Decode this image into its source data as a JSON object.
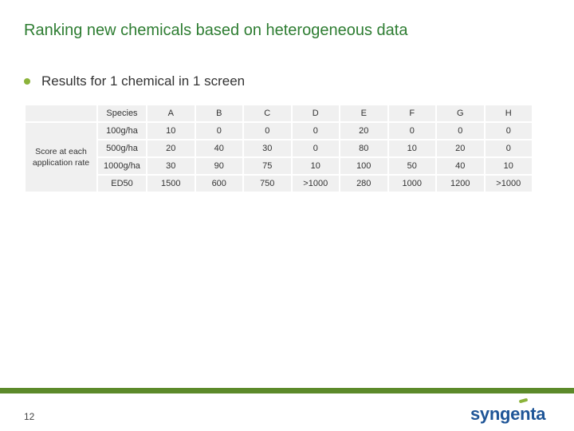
{
  "slide": {
    "title": "Ranking new chemicals based on heterogeneous data",
    "bullet": "Results for 1 chemical in 1 screen",
    "page_number": "12",
    "logo_text": "syngenta"
  },
  "table": {
    "row_group_label": "Score at each application rate",
    "header_label": "Species",
    "species": [
      "A",
      "B",
      "C",
      "D",
      "E",
      "F",
      "G",
      "H"
    ],
    "rows": [
      {
        "label": "100g/ha",
        "values": [
          "10",
          "0",
          "0",
          "0",
          "20",
          "0",
          "0",
          "0"
        ]
      },
      {
        "label": "500g/ha",
        "values": [
          "20",
          "40",
          "30",
          "0",
          "80",
          "10",
          "20",
          "0"
        ]
      },
      {
        "label": "1000g/ha",
        "values": [
          "30",
          "90",
          "75",
          "10",
          "100",
          "50",
          "40",
          "10"
        ]
      },
      {
        "label": "ED50",
        "values": [
          "1500",
          "600",
          "750",
          ">1000",
          "280",
          "1000",
          "1200",
          ">1000"
        ]
      }
    ]
  },
  "colors": {
    "title": "#2e7d32",
    "accent_green": "#8bb33a",
    "footer_bar": "#5c8a2a",
    "logo_blue": "#1f5597",
    "cell_bg": "#f0f0f0"
  }
}
